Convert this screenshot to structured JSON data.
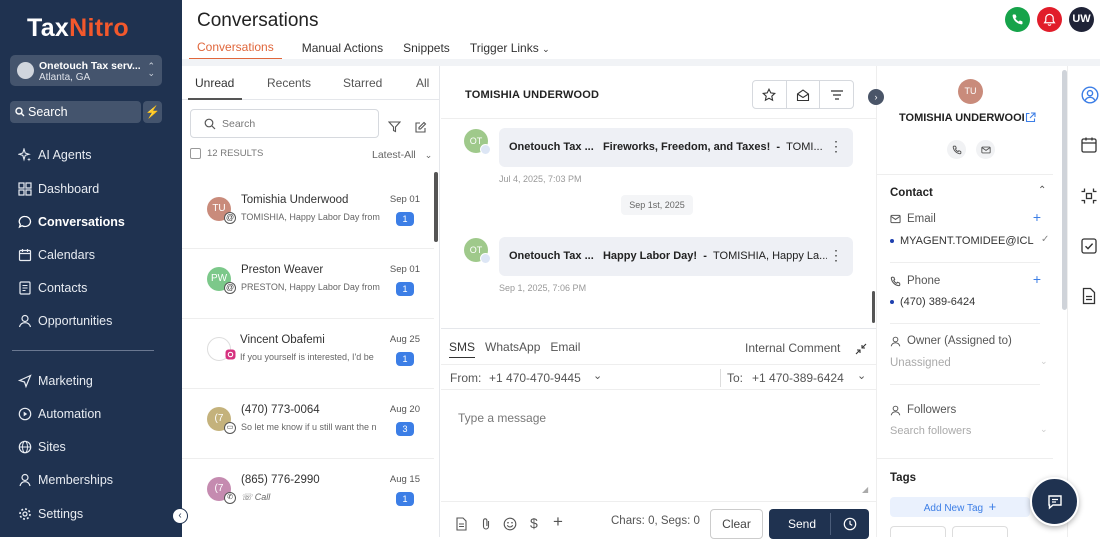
{
  "brand": {
    "part1": "Tax",
    "part2": "Nitr",
    "part3": "o"
  },
  "account": {
    "name": "Onetouch Tax serv...",
    "location": "Atlanta, GA"
  },
  "sidebar": {
    "search_label": "Search",
    "items": [
      {
        "label": "AI Agents",
        "icon": "sparkles-icon"
      },
      {
        "label": "Dashboard",
        "icon": "grid-icon"
      },
      {
        "label": "Conversations",
        "icon": "chat-icon",
        "active": true
      },
      {
        "label": "Calendars",
        "icon": "calendar-icon"
      },
      {
        "label": "Contacts",
        "icon": "contacts-icon"
      },
      {
        "label": "Opportunities",
        "icon": "user-icon"
      },
      {
        "label": "Marketing",
        "icon": "send-icon"
      },
      {
        "label": "Automation",
        "icon": "play-icon"
      },
      {
        "label": "Sites",
        "icon": "globe-icon"
      },
      {
        "label": "Memberships",
        "icon": "member-icon"
      },
      {
        "label": "Settings",
        "icon": "gear-icon"
      }
    ]
  },
  "header": {
    "title": "Conversations",
    "tabs": [
      "Conversations",
      "Manual Actions",
      "Snippets",
      "Trigger Links"
    ],
    "user_initials": "UW"
  },
  "list": {
    "tabs": [
      "Unread",
      "Recents",
      "Starred",
      "All"
    ],
    "search_placeholder": "Search",
    "results": "12 RESULTS",
    "sort": "Latest-All",
    "items": [
      {
        "initials": "TU",
        "name": "Tomishia Underwood",
        "preview": "TOMISHIA, Happy Labor Day from",
        "date": "Sep 01",
        "count": "1",
        "color": "#c98b7b"
      },
      {
        "initials": "PW",
        "name": "Preston Weaver",
        "preview": "PRESTON, Happy Labor Day from (",
        "date": "Sep 01",
        "count": "1",
        "color": "#7cc88a"
      },
      {
        "initials": "",
        "name": "Vincent Obafemi",
        "preview": "If you yourself is interested, I'd be",
        "date": "Aug 25",
        "count": "1",
        "color": "#ffffff"
      },
      {
        "initials": "(7",
        "name": "(470) 773-0064",
        "preview": "So let me know if u still want the n",
        "date": "Aug 20",
        "count": "3",
        "color": "#c4b27c"
      },
      {
        "initials": "(7",
        "name": "(865) 776-2990",
        "preview": "Call",
        "date": "Aug 15",
        "count": "1",
        "color": "#c58bb0"
      }
    ]
  },
  "thread": {
    "contact_name": "TOMISHIA UNDERWOOD",
    "messages": [
      {
        "avatar": "OT",
        "sender": "Onetouch Tax ...",
        "subject": "Fireworks, Freedom, and Taxes!",
        "sep": "-",
        "snippet": "TOMI...",
        "time": "Jul 4, 2025, 7:03 PM"
      },
      {
        "avatar": "OT",
        "sender": "Onetouch Tax ...",
        "subject": "Happy Labor Day!",
        "sep": "-",
        "snippet": "TOMISHIA, Happy La...",
        "time": "Sep 1, 2025, 7:06 PM"
      }
    ],
    "date_divider": "Sep 1st, 2025"
  },
  "composer": {
    "tabs": [
      "SMS",
      "WhatsApp",
      "Email"
    ],
    "internal_comment": "Internal Comment",
    "from_label": "From:",
    "from_value": "+1 470-470-9445",
    "to_label": "To:",
    "to_value": "+1 470-389-6424",
    "placeholder": "Type a message",
    "chars": "Chars: 0, Segs: 0",
    "clear": "Clear",
    "send": "Send"
  },
  "contact": {
    "initials": "TU",
    "name": "TOMISHIA UNDERWOOI",
    "section_title": "Contact",
    "email_label": "Email",
    "email_value": "MYAGENT.TOMIDEE@ICL",
    "phone_label": "Phone",
    "phone_value": "(470) 389-6424",
    "owner_label": "Owner (Assigned to)",
    "owner_value": "Unassigned",
    "followers_label": "Followers",
    "followers_placeholder": "Search followers",
    "tags_title": "Tags",
    "add_tag": "Add New Tag"
  },
  "colors": {
    "sidebar": "#1f3250",
    "accent": "#e0663b",
    "blue": "#3c7ee6",
    "call": "#16a34a",
    "alert": "#e11d2a"
  }
}
